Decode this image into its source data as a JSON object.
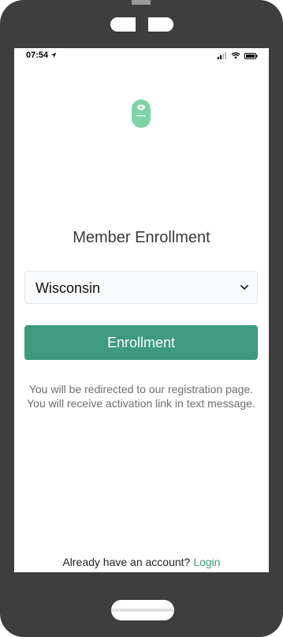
{
  "status_bar": {
    "time": "07:54"
  },
  "logo": {
    "icon": "app-logo-icon",
    "color": "#7fd4a6"
  },
  "enrollment": {
    "title": "Member Enrollment",
    "state_select": {
      "selected": "Wisconsin"
    },
    "button_label": "Enrollment",
    "info_text": "You will be redirected to our registration page. You will receive activation link in text message."
  },
  "footer": {
    "prompt": "Already have an account?",
    "login_label": "Login"
  },
  "colors": {
    "accent": "#3d9a7d",
    "frame": "#3e3e3e"
  }
}
